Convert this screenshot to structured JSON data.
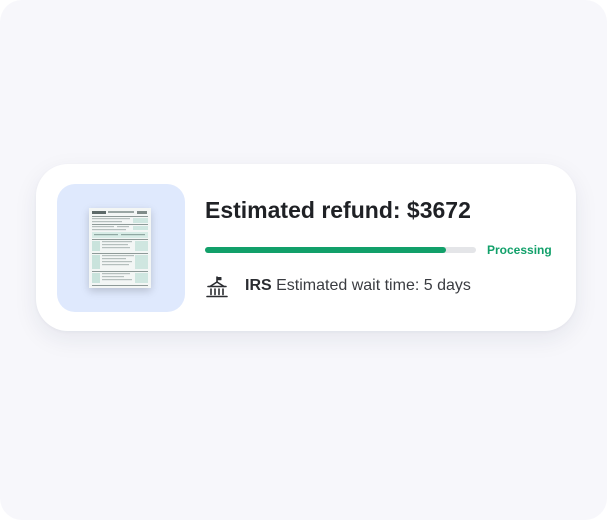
{
  "refund_card": {
    "title": "Estimated refund: $3672",
    "progress": {
      "fraction": 0.89,
      "status_label": "Processing",
      "fill_color": "#12a06a",
      "status_color": "#12a06a"
    },
    "wait": {
      "agency": "IRS",
      "text": "Estimated wait time: 5 days",
      "icon": "government-building-icon"
    },
    "thumbnail": {
      "icon": "tax-form-document-icon",
      "background_color": "#dfe9fd"
    }
  }
}
